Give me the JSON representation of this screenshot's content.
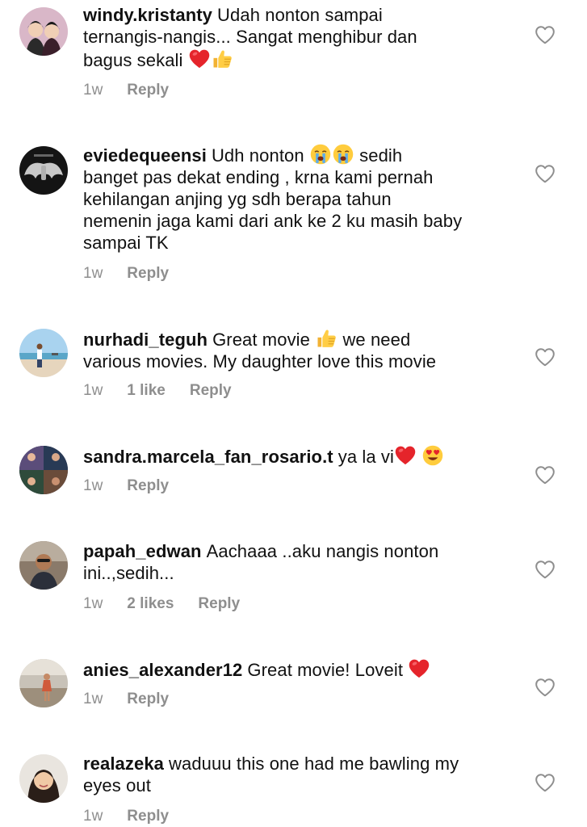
{
  "comments": [
    {
      "username": "windy.kristanty",
      "text_lines": [
        "Udah nonton sampai",
        "ternangis-nangis... Sangat menghibur dan",
        "bagus sekali"
      ],
      "emoji_after": [
        "red-heart-emoji",
        "thumbs-up-emoji"
      ],
      "time": "1w",
      "likes": "",
      "reply": "Reply"
    },
    {
      "username": "eviedequeensi",
      "text_part1": "Udh nonton",
      "text_part2": "sedih",
      "text_lines": [
        "banget pas dekat ending , krna kami pernah",
        "kehilangan anjing yg sdh berapa tahun",
        "nemenin jaga kami dari ank ke 2 ku masih baby",
        "sampai TK"
      ],
      "emoji_mid": [
        "crying-face-emoji",
        "crying-face-emoji"
      ],
      "time": "1w",
      "likes": "",
      "reply": "Reply"
    },
    {
      "username": "nurhadi_teguh",
      "text_part1": "Great movie",
      "text_part2": "we need",
      "text_lines": [
        "various movies.  My daughter love this movie"
      ],
      "emoji_mid": [
        "thumbs-up-emoji"
      ],
      "time": "1w",
      "likes": "1 like",
      "reply": "Reply"
    },
    {
      "username": "sandra.marcela_fan_rosario.t",
      "text_part1": "ya la vi",
      "emoji_after": [
        "red-heart-emoji",
        "heart-eyes-emoji"
      ],
      "time": "1w",
      "likes": "",
      "reply": "Reply"
    },
    {
      "username": "papah_edwan",
      "text_part1": "Aachaaa ..aku nangis nonton",
      "text_lines": [
        "ini..,sedih..."
      ],
      "time": "1w",
      "likes": "2 likes",
      "reply": "Reply"
    },
    {
      "username": "anies_alexander12",
      "text_part1": "Great movie! Loveit",
      "emoji_after": [
        "red-heart-emoji"
      ],
      "time": "1w",
      "likes": "",
      "reply": "Reply"
    },
    {
      "username": "realazeka",
      "text_part1": "waduuu this one had me bawling my",
      "text_lines": [
        "eyes out"
      ],
      "time": "1w",
      "likes": "",
      "reply": "Reply"
    }
  ],
  "colors": {
    "text": "#111111",
    "meta": "#8e8e8e",
    "heart_outline": "#8e8e8e"
  }
}
